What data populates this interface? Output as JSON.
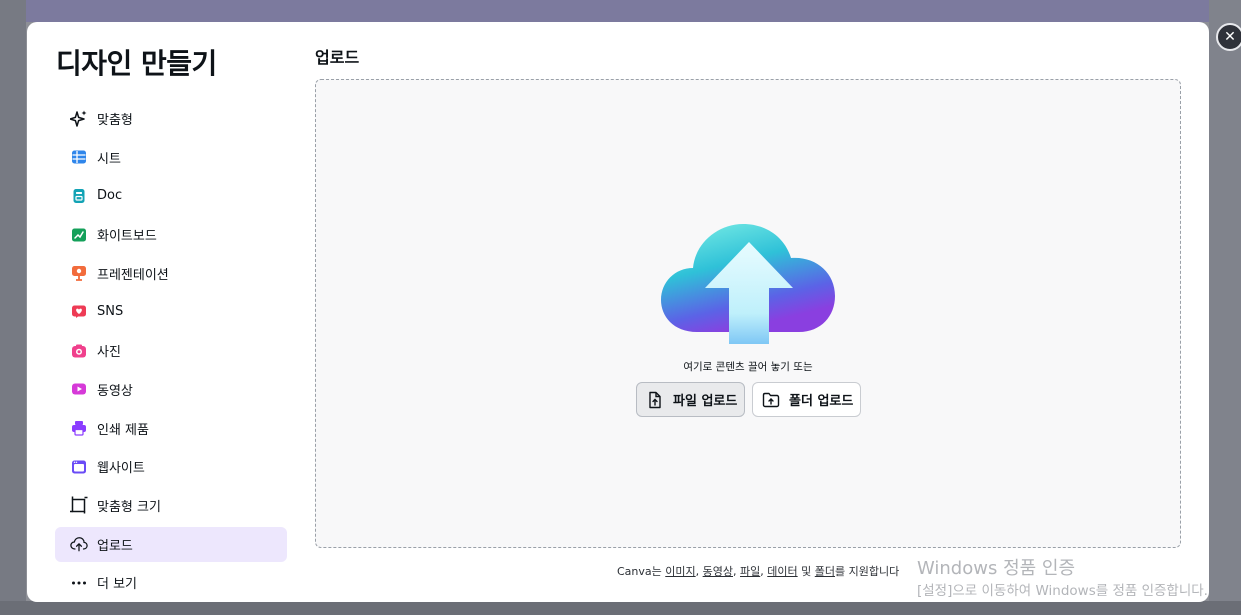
{
  "modal": {
    "title": "디자인 만들기",
    "close_label": "✕"
  },
  "menu": [
    {
      "label": "맞춤형",
      "icon": "sparkle-icon"
    },
    {
      "label": "시트",
      "icon": "sheet-icon"
    },
    {
      "label": "Doc",
      "icon": "doc-icon"
    },
    {
      "label": "화이트보드",
      "icon": "whiteboard-icon"
    },
    {
      "label": "프레젠테이션",
      "icon": "presentation-icon"
    },
    {
      "label": "SNS",
      "icon": "heart-icon"
    },
    {
      "label": "사진",
      "icon": "camera-icon"
    },
    {
      "label": "동영상",
      "icon": "video-icon"
    },
    {
      "label": "인쇄 제품",
      "icon": "printer-icon"
    },
    {
      "label": "웹사이트",
      "icon": "website-icon"
    },
    {
      "label": "맞춤형 크기",
      "icon": "custom-size-icon"
    },
    {
      "label": "업로드",
      "icon": "cloud-upload-icon",
      "active": true
    },
    {
      "label": "더 보기",
      "icon": "more-icon"
    }
  ],
  "upload": {
    "title": "업로드",
    "drop_text": "여기로 콘텐츠 끌어 놓기 또는",
    "file_button": "파일 업로드",
    "folder_button": "폴더 업로드"
  },
  "footer": {
    "prefix": "Canva는 ",
    "links": [
      "이미지",
      "동영상",
      "파일",
      "데이터",
      "폴더"
    ],
    "sep1": ", ",
    "sep2": ", ",
    "sep3": ", ",
    "sep4": " 및 ",
    "suffix": "를 지원합니다"
  },
  "watermark": {
    "line1": "Windows 정품 인증",
    "line2": "[설정]으로 이동하여 Windows를 정품 인증합니다."
  },
  "colors": {
    "accent": "#8b3dff",
    "active_bg": "#ede7fd"
  }
}
